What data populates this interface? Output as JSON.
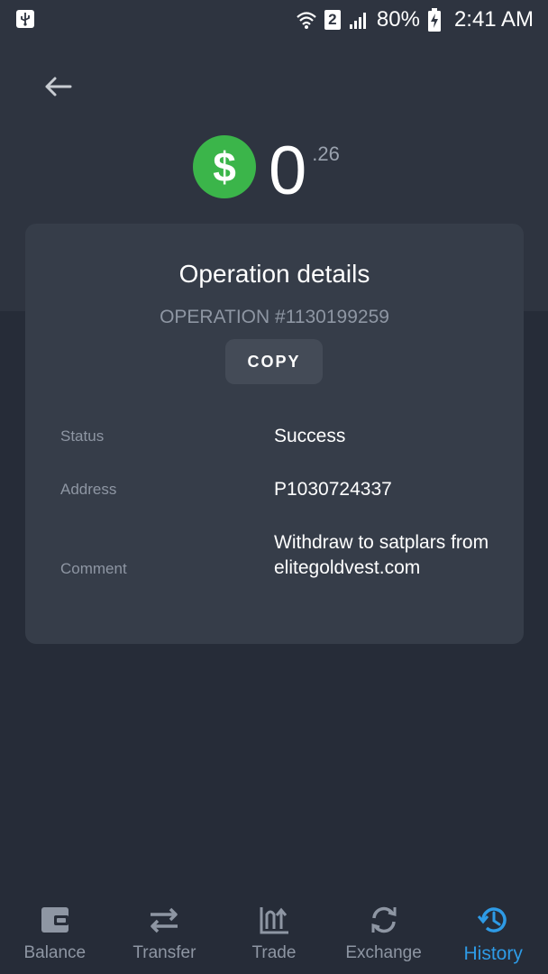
{
  "status_bar": {
    "sim_slot": "2",
    "battery": "80%",
    "time": "2:41 AM"
  },
  "balance": {
    "integer": "0",
    "decimal": ".26",
    "currency_symbol": "$",
    "badge_color": "#3bb54a"
  },
  "card": {
    "title": "Operation details",
    "operation_id": "OPERATION #1130199259",
    "copy_label": "COPY",
    "rows": [
      {
        "label": "Status",
        "value": "Success"
      },
      {
        "label": "Address",
        "value": "P1030724337"
      },
      {
        "label": "Comment",
        "value": "Withdraw to satplars from elitegoldvest.com"
      }
    ]
  },
  "nav": {
    "active_color": "#2e9be6",
    "items": [
      {
        "label": "Balance",
        "icon": "wallet-icon"
      },
      {
        "label": "Transfer",
        "icon": "transfer-icon"
      },
      {
        "label": "Trade",
        "icon": "trade-icon"
      },
      {
        "label": "Exchange",
        "icon": "exchange-icon"
      },
      {
        "label": "History",
        "icon": "history-icon",
        "active": true
      }
    ]
  }
}
